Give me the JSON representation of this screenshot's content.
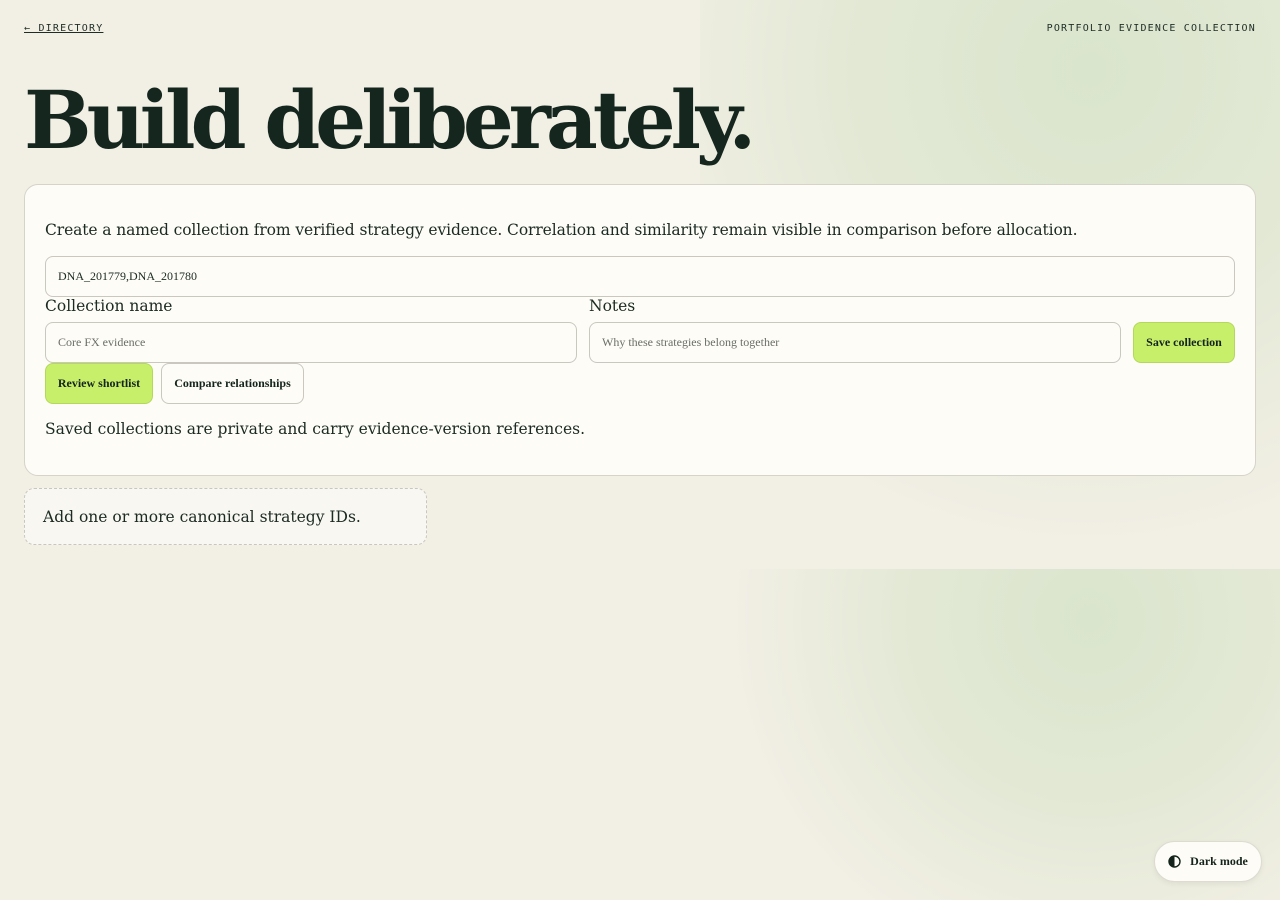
{
  "nav": {
    "back_link": "← DIRECTORY",
    "section_label": "PORTFOLIO EVIDENCE COLLECTION"
  },
  "hero": {
    "title": "Build deliberately."
  },
  "panel": {
    "intro": "Create a named collection from verified strategy evidence. Correlation and similarity remain visible in comparison before allocation.",
    "strategy_ids": {
      "value": "DNA_201779,DNA_201780"
    },
    "collection_name": {
      "label": "Collection name",
      "placeholder": "Core FX evidence"
    },
    "notes": {
      "label": "Notes",
      "placeholder": "Why these strategies belong together"
    },
    "buttons": {
      "save": "Save collection",
      "review": "Review shortlist",
      "compare": "Compare relationships"
    },
    "saved_note": "Saved collections are private and carry evidence-version references."
  },
  "empty_state": {
    "message": "Add one or more canonical strategy IDs."
  },
  "theme_toggle": {
    "label": "Dark mode",
    "icon": "contrast-icon"
  },
  "colors": {
    "accent": "#c8ef6a",
    "ink": "#14241c",
    "background": "#f2efe5"
  }
}
